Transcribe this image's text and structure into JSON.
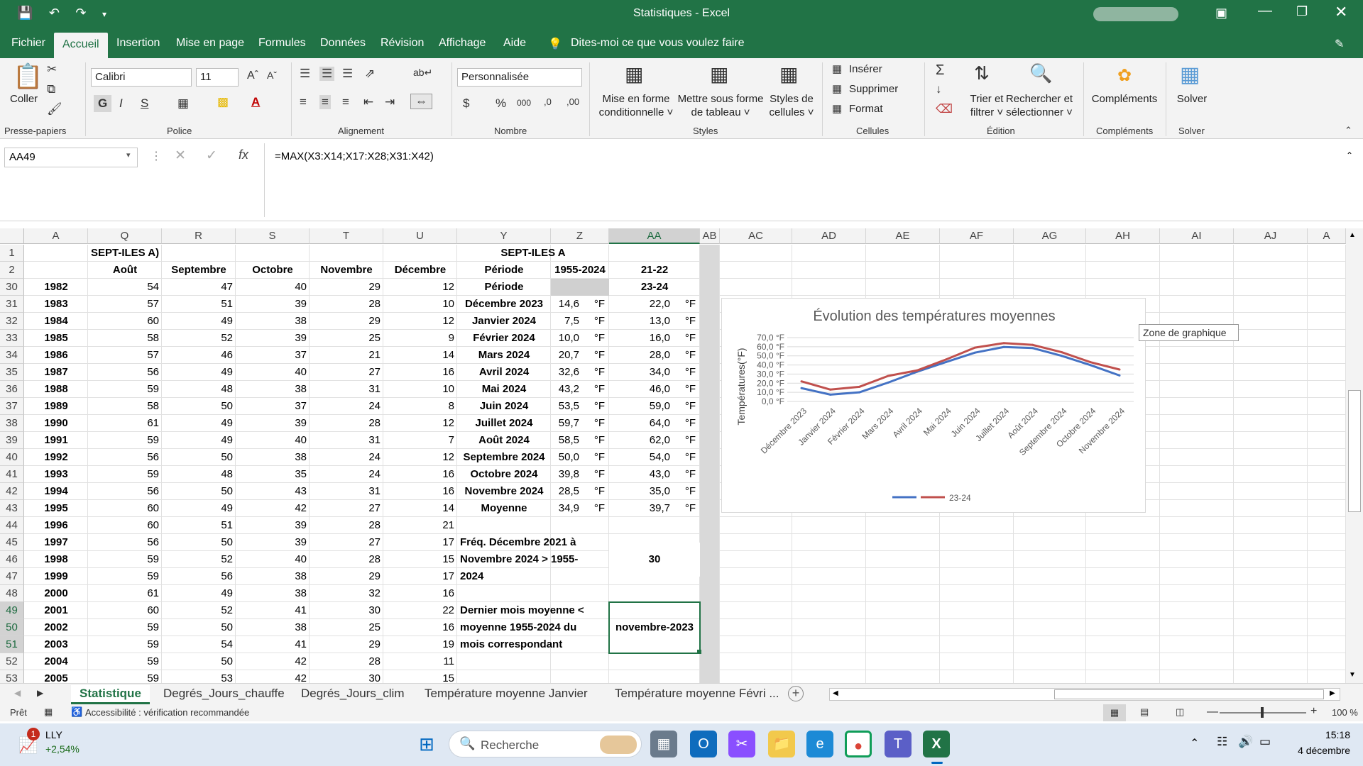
{
  "titlebar": {
    "title": "Statistiques  -  Excel"
  },
  "menu": {
    "items": [
      "Fichier",
      "Accueil",
      "Insertion",
      "Mise en page",
      "Formules",
      "Données",
      "Révision",
      "Affichage",
      "Aide",
      "Dites-moi ce que vous voulez faire"
    ]
  },
  "ribbon": {
    "paste_label": "Coller",
    "font_name": "Calibri",
    "font_size": "11",
    "number_format": "Personnalisée",
    "cond_format": "Mise en forme conditionnelle ˅",
    "format_table": "Mettre sous forme de tableau ˅",
    "cell_styles": "Styles de cellules ˅",
    "insert": "Insérer",
    "delete": "Supprimer",
    "format": "Format",
    "sort_filter": "Trier et filtrer ˅",
    "find_select": "Rechercher et sélectionner ˅",
    "addins": "Compléments",
    "solver": "Solver",
    "groups": [
      "Presse-papiers",
      "Police",
      "Alignement",
      "Nombre",
      "Styles",
      "Cellules",
      "Édition",
      "Compléments",
      "Solver"
    ]
  },
  "formula_bar": {
    "name_box": "AA49",
    "formula": "=MAX(X3:X14;X17:X28;X31:X42)"
  },
  "columns": [
    "A",
    "Q",
    "R",
    "S",
    "T",
    "U",
    "Y",
    "Z",
    "AA",
    "AB",
    "AC",
    "AD",
    "AE",
    "AF",
    "AG",
    "AH",
    "AI",
    "AJ",
    "A"
  ],
  "row_numbers": [
    "1",
    "2",
    "30",
    "31",
    "32",
    "33",
    "34",
    "35",
    "36",
    "37",
    "38",
    "39",
    "40",
    "41",
    "42",
    "43",
    "44",
    "45",
    "46",
    "47",
    "48",
    "49",
    "50",
    "51",
    "52",
    "53"
  ],
  "header_rows": {
    "r1": {
      "q": "SEPT-ILES A)",
      "y": "SEPT-ILES A"
    },
    "r2": {
      "q": "Août",
      "r": "Septembre",
      "s": "Octobre",
      "t": "Novembre",
      "u": "Décembre",
      "y": "Période",
      "z": "1955-2024",
      "aa": "21-22"
    }
  },
  "year_rows": [
    [
      "1982",
      "54",
      "47",
      "40",
      "29",
      "12"
    ],
    [
      "1983",
      "57",
      "51",
      "39",
      "28",
      "10"
    ],
    [
      "1984",
      "60",
      "49",
      "38",
      "29",
      "12"
    ],
    [
      "1985",
      "58",
      "52",
      "39",
      "25",
      "9"
    ],
    [
      "1986",
      "57",
      "46",
      "37",
      "21",
      "14"
    ],
    [
      "1987",
      "56",
      "49",
      "40",
      "27",
      "16"
    ],
    [
      "1988",
      "59",
      "48",
      "38",
      "31",
      "10"
    ],
    [
      "1989",
      "58",
      "50",
      "37",
      "24",
      "8"
    ],
    [
      "1990",
      "61",
      "49",
      "39",
      "28",
      "12"
    ],
    [
      "1991",
      "59",
      "49",
      "40",
      "31",
      "7"
    ],
    [
      "1992",
      "56",
      "50",
      "38",
      "24",
      "12"
    ],
    [
      "1993",
      "59",
      "48",
      "35",
      "24",
      "16"
    ],
    [
      "1994",
      "56",
      "50",
      "43",
      "31",
      "16"
    ],
    [
      "1995",
      "60",
      "49",
      "42",
      "27",
      "14"
    ],
    [
      "1996",
      "60",
      "51",
      "39",
      "28",
      "21"
    ],
    [
      "1997",
      "56",
      "50",
      "39",
      "27",
      "17"
    ],
    [
      "1998",
      "59",
      "52",
      "40",
      "28",
      "15"
    ],
    [
      "1999",
      "59",
      "56",
      "38",
      "29",
      "17"
    ],
    [
      "2000",
      "61",
      "49",
      "38",
      "32",
      "16"
    ],
    [
      "2001",
      "60",
      "52",
      "41",
      "30",
      "22"
    ],
    [
      "2002",
      "59",
      "50",
      "38",
      "25",
      "16"
    ],
    [
      "2003",
      "59",
      "54",
      "41",
      "29",
      "19"
    ],
    [
      "2004",
      "59",
      "50",
      "42",
      "28",
      "11"
    ],
    [
      "2005",
      "59",
      "53",
      "42",
      "30",
      "15"
    ]
  ],
  "period_header": {
    "y": "Période",
    "aa": "23-24"
  },
  "period_rows": [
    [
      "Décembre 2023",
      "14,6",
      "22,0"
    ],
    [
      "Janvier 2024",
      "7,5",
      "13,0"
    ],
    [
      "Février 2024",
      "10,0",
      "16,0"
    ],
    [
      "Mars 2024",
      "20,7",
      "28,0"
    ],
    [
      "Avril 2024",
      "32,6",
      "34,0"
    ],
    [
      "Mai 2024",
      "43,2",
      "46,0"
    ],
    [
      "Juin 2024",
      "53,5",
      "59,0"
    ],
    [
      "Juillet 2024",
      "59,7",
      "64,0"
    ],
    [
      "Août 2024",
      "58,5",
      "62,0"
    ],
    [
      "Septembre 2024",
      "50,0",
      "54,0"
    ],
    [
      "Octobre 2024",
      "39,8",
      "43,0"
    ],
    [
      "Novembre 2024",
      "28,5",
      "35,0"
    ],
    [
      "Moyenne",
      "34,9",
      "39,7"
    ]
  ],
  "unit": "°F",
  "freq": {
    "label_lines": [
      "Fréq. Décembre 2021 à",
      "Novembre 2024 > 1955-",
      "2024"
    ],
    "value": "30"
  },
  "last_month": {
    "label_lines": [
      "Dernier mois moyenne <",
      "moyenne 1955-2024 du",
      "mois correspondant"
    ],
    "value": "novembre-2023"
  },
  "chart_data": {
    "type": "line",
    "title": "Évolution des températures moyennes",
    "ylabel": "Températures(°F)",
    "categories": [
      "Décembre 2023",
      "Janvier 2024",
      "Février 2024",
      "Mars 2024",
      "Avril 2024",
      "Mai 2024",
      "Juin 2024",
      "Juillet 2024",
      "Août 2024",
      "Septembre 2024",
      "Octobre 2024",
      "Novembre 2024"
    ],
    "ylim": [
      0,
      70
    ],
    "yticks": [
      "70,0 °F",
      "60,0 °F",
      "50,0 °F",
      "40,0 °F",
      "30,0 °F",
      "20,0 °F",
      "10,0 °F",
      "0,0 °F"
    ],
    "series": [
      {
        "name": "",
        "color": "#4472c4",
        "values": [
          14.6,
          7.5,
          10.0,
          20.7,
          32.6,
          43.2,
          53.5,
          59.7,
          58.5,
          50.0,
          39.8,
          28.5
        ]
      },
      {
        "name": "23-24",
        "color": "#c0504d",
        "values": [
          22.0,
          13.0,
          16.0,
          28.0,
          34.0,
          46.0,
          59.0,
          64.0,
          62.0,
          54.0,
          43.0,
          35.0
        ]
      }
    ],
    "legend": "bottom",
    "grid": true
  },
  "tooltip": "Zone de graphique",
  "sheet_tabs": [
    "Statistique",
    "Degrés_Jours_chauffe",
    "Degrés_Jours_clim",
    "Température moyenne Janvier",
    "Température moyenne Févri ..."
  ],
  "status": {
    "ready": "Prêt",
    "accessibility": "Accessibilité : vérification recommandée",
    "zoom": "100 %"
  },
  "taskbar": {
    "stock_name": "LLY",
    "stock_change": "+2,54%",
    "search": "Recherche",
    "time": "15:18",
    "date": "4 décembre",
    "notif": "1"
  }
}
